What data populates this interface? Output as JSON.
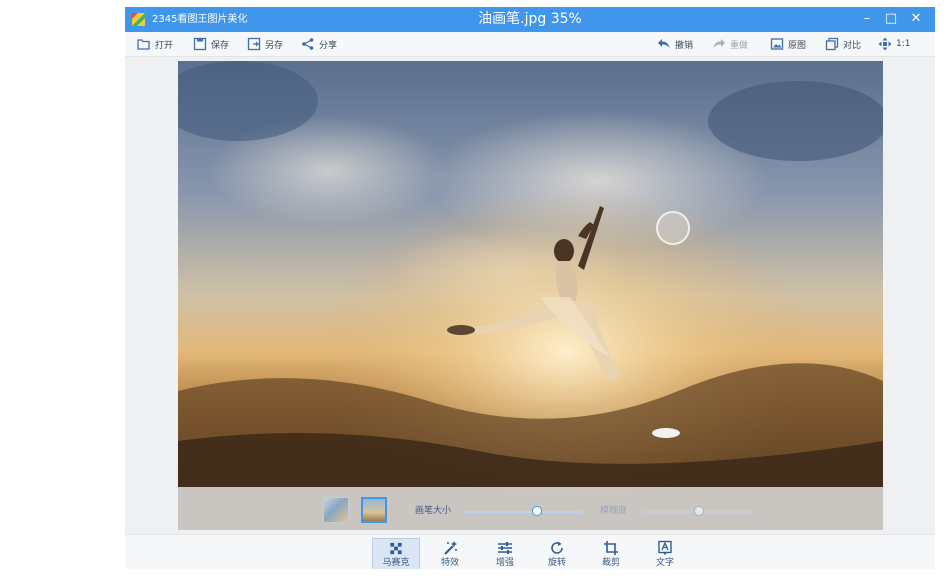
{
  "titlebar": {
    "app_name": "2345看图王图片美化",
    "document_title": "油画笔.jpg 35%",
    "minimize": "–",
    "maximize": "□",
    "close": "✕"
  },
  "toolbar": {
    "open": "打开",
    "save": "保存",
    "save_as": "另存",
    "share": "分享",
    "undo": "撤销",
    "redo": "重做",
    "original": "原图",
    "compare": "对比",
    "actual_size": "1:1"
  },
  "brush_panel": {
    "brush_size_label": "画笔大小",
    "brush_size_value": 0.62,
    "blur_label": "模糊度",
    "blur_value": 0.5,
    "selected_style_index": 1
  },
  "tools": [
    {
      "label": "马赛克",
      "icon": "mosaic-icon",
      "active": true
    },
    {
      "label": "特效",
      "icon": "magic-wand-icon",
      "active": false
    },
    {
      "label": "增强",
      "icon": "sliders-icon",
      "active": false
    },
    {
      "label": "旋转",
      "icon": "rotate-icon",
      "active": false
    },
    {
      "label": "裁剪",
      "icon": "crop-icon",
      "active": false
    },
    {
      "label": "文字",
      "icon": "text-icon",
      "active": false
    }
  ],
  "colors": {
    "accent": "#3f96ea",
    "toolbar_text": "#3a4a5c",
    "active_tool_bg": "#dae6f3"
  }
}
